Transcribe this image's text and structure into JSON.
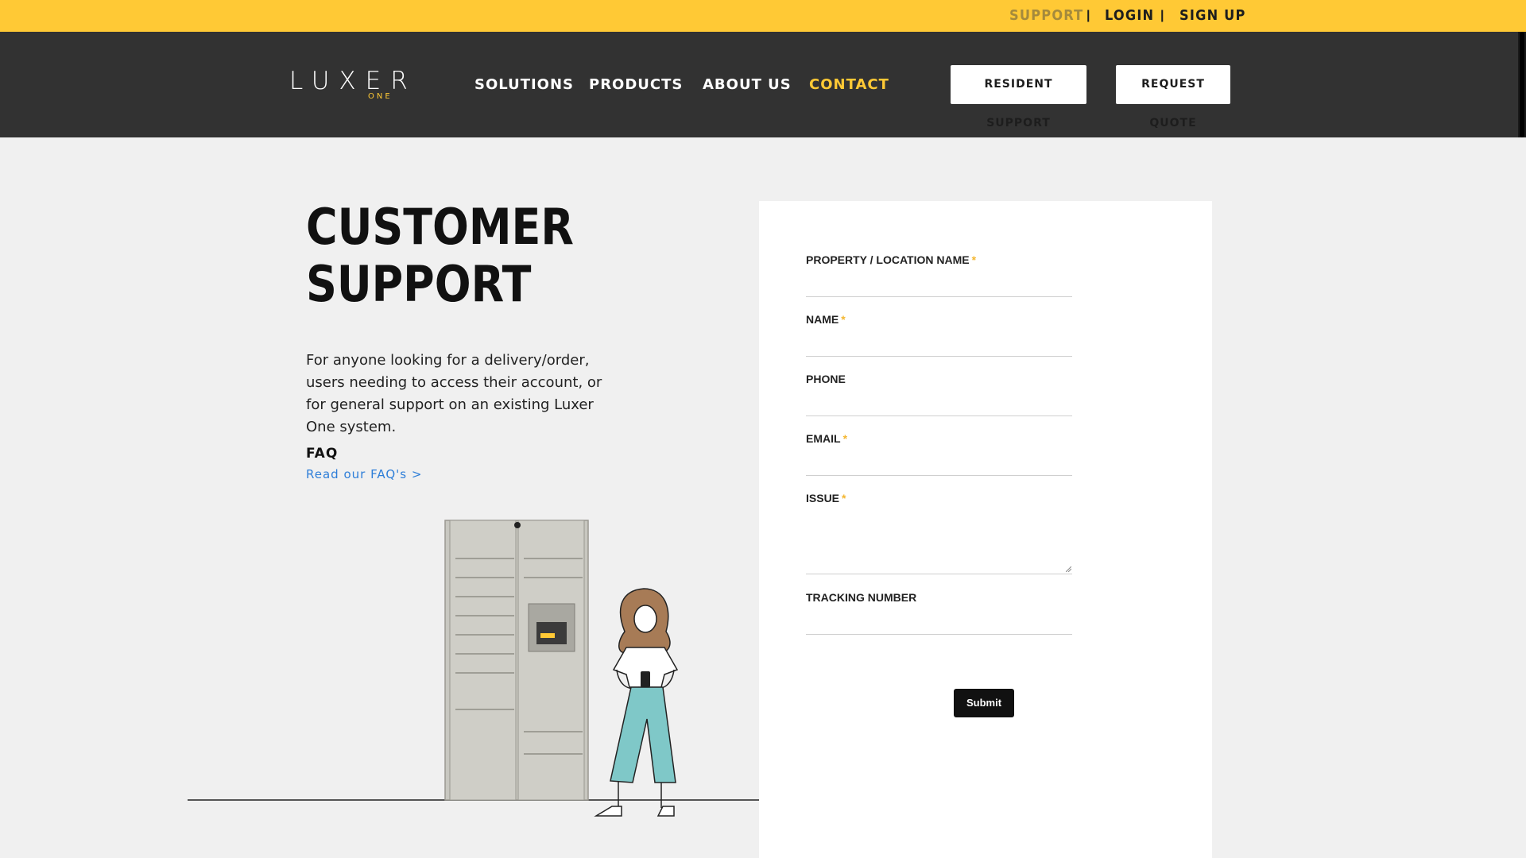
{
  "topbar": {
    "support": "SUPPORT",
    "sep1": "|",
    "login": "LOGIN",
    "sep2": "|",
    "signup": "SIGN UP"
  },
  "logo": {
    "word": "LUXER",
    "sub": "ONE"
  },
  "nav": {
    "items": [
      {
        "label": "SOLUTIONS"
      },
      {
        "label": "PRODUCTS"
      },
      {
        "label": "ABOUT US"
      },
      {
        "label": "CONTACT",
        "active": true
      }
    ],
    "resident_support": "RESIDENT SUPPORT",
    "request_quote": "REQUEST QUOTE"
  },
  "main": {
    "title_line1": "CUSTOMER",
    "title_line2": "SUPPORT",
    "intro": "For anyone looking for a delivery/order, users needing to access their account, or for general support on an existing Luxer One system.",
    "faq_heading": "FAQ",
    "faq_link": "Read our FAQ's >"
  },
  "form": {
    "fields": [
      {
        "label": "PROPERTY / LOCATION NAME",
        "required": "*",
        "value": ""
      },
      {
        "label": "NAME",
        "required": "*",
        "value": ""
      },
      {
        "label": "PHONE",
        "required": "",
        "value": ""
      },
      {
        "label": "EMAIL",
        "required": "*",
        "value": ""
      },
      {
        "label": "ISSUE",
        "required": "*",
        "value": ""
      },
      {
        "label": "TRACKING NUMBER",
        "required": "",
        "value": ""
      }
    ],
    "submit": "Submit"
  },
  "colors": {
    "accent_yellow": "#ffc935",
    "nav_bg": "#323232",
    "link_blue": "#2e7ed8",
    "required_star": "#f4b731"
  }
}
